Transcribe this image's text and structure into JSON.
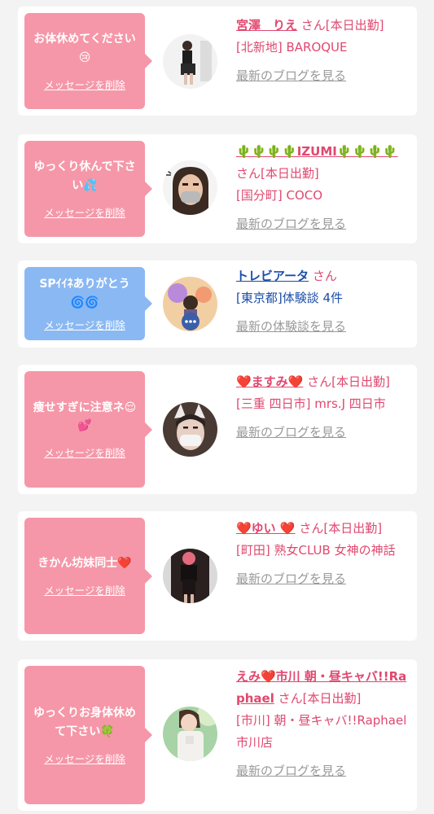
{
  "messages": [
    {
      "message": "お体休めてください😢",
      "delete_label": "メッセージを削除",
      "name": "宮澤　りえ",
      "suffix": "さん[本日出勤]",
      "shop": "[北新地] BAROQUE",
      "link": "最新のブログを見る"
    },
    {
      "message": "ゆっくり休んで下さい💦",
      "delete_label": "メッセージを削除",
      "name": "🌵🌵🌵🌵IZUMI🌵🌵🌵🌵",
      "suffix": "さん[本日出勤]",
      "shop": "[国分町] COCO",
      "link": "最新のブログを見る"
    },
    {
      "message": "SPｲｲﾈありがとう🌀🌀",
      "delete_label": "メッセージを削除",
      "name": "トレビアータ",
      "suffix": "さん",
      "shop": "[東京都]体験談 4件",
      "link": "最新の体験談を見る"
    },
    {
      "message": "痩せすぎに注意ネ😌💕",
      "delete_label": "メッセージを削除",
      "name": "❤️ますみ❤️",
      "suffix": "さん[本日出勤]",
      "shop": "[三重 四日市] mrs.J 四日市",
      "link": "最新のブログを見る"
    },
    {
      "message": "きかん坊妹同士❤️",
      "delete_label": "メッセージを削除",
      "name": "❤️ゆい ❤️",
      "suffix": "さん[本日出勤]",
      "shop": "[町田] 熟女CLUB 女神の神話",
      "link": "最新のブログを見る"
    },
    {
      "message": "ゆっくりお身体休めて下さい🍀",
      "delete_label": "メッセージを削除",
      "name": "えみ❤️市川 朝・昼キャバ!!Raphael",
      "suffix": "さん[本日出勤]",
      "shop": "[市川] 朝・昼キャバ!!Raphael 市川店",
      "link": "最新のブログを見る"
    }
  ]
}
